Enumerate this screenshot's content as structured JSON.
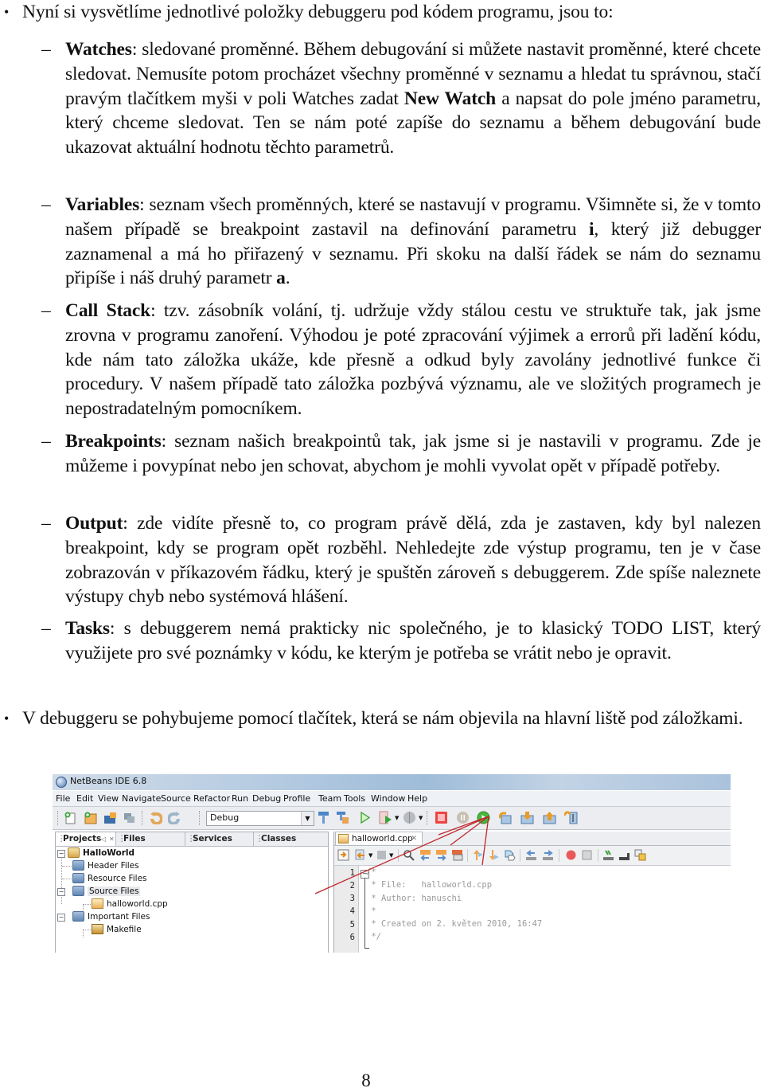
{
  "intro": {
    "bullet": "•",
    "text": "Nyní si vysvětlíme jednotlivé položky debuggeru pod kódem programu, jsou to:"
  },
  "items": [
    {
      "term": "Watches",
      "text_before": ": sledované proměnné. Během debugování si můžete nastavit proměnné, které chcete sledovat. Nemusíte potom procházet všechny proměnné v seznamu a hledat tu správnou, stačí pravým tlačítkem myši v poli Watches zadat ",
      "bold_inline": "New Watch",
      "text_after": " a napsat do pole jméno parametru, který chceme sledovat. Ten se nám poté zapíše do seznamu a během debugování bude ukazovat aktuální hodnotu těchto parametrů."
    },
    {
      "term": "Variables",
      "text_before": ": seznam všech proměnných, které se nastavují v programu. Všimněte si, že v tomto našem případě se breakpoint zastavil na definování parametru ",
      "bold_inline": "i",
      "text_middle": ", který již debugger zaznamenal a má ho přiřazený v seznamu. Při skoku na další řádek se nám do seznamu připíše i náš druhý parametr ",
      "bold_inline2": "a",
      "text_after": "."
    },
    {
      "term": "Call Stack",
      "text": ": tzv. zásobník volání, tj. udržuje vždy stálou cestu ve struktuře tak, jak jsme zrovna v programu zanoření. Výhodou je poté zpracování výjimek a errorů při ladění kódu, kde nám tato záložka ukáže, kde přesně a odkud byly zavolány jednotlivé funkce či procedury. V našem případě tato záložka pozbývá významu, ale ve složitých programech je nepostradatelným pomocníkem."
    },
    {
      "term": "Breakpoints",
      "text": ": seznam našich breakpointů tak, jak jsme si je nastavili v programu. Zde je můžeme i povypínat nebo jen schovat, abychom je mohli vyvolat opět v případě potřeby."
    },
    {
      "term": "Output",
      "text": ": zde vidíte přesně to, co program právě dělá, zda je zastaven, kdy byl nalezen breakpoint, kdy se program opět rozběhl. Nehledejte zde výstup programu, ten je v čase zobrazován v příkazovém řádku, který je spuštěn zároveň s debuggerem. Zde spíše naleznete výstupy chyb nebo systémová hlášení."
    },
    {
      "term": "Tasks",
      "text": ": s debuggerem nemá prakticky nic společného, je to klasický TODO LIST, který využijete pro své poznámky v kódu, ke kterým je potřeba se vrátit nebo je opravit."
    }
  ],
  "dash": "–",
  "closing": {
    "bullet": "•",
    "text": "V debuggeru se pohybujeme pomocí tlačítek, která se nám objevila na hlavní liště pod záložkami."
  },
  "screenshot": {
    "window_title": "NetBeans IDE 6.8",
    "menu": [
      "File",
      "Edit",
      "View",
      "Navigate",
      "Source",
      "Refactor",
      "Run",
      "Debug",
      "Profile",
      "Team",
      "Tools",
      "Window",
      "Help"
    ],
    "toolbar_icons": [
      "new-file-icon",
      "new-project-icon",
      "open-project-icon",
      "close-project-icon",
      "undo-icon",
      "redo-icon",
      "build-icon",
      "clean-build-icon",
      "run-icon",
      "debug-project-icon",
      "profile-icon",
      "finish-debugger-session-icon",
      "pause-icon",
      "continue-icon",
      "step-over-icon",
      "step-into-icon",
      "step-out-icon",
      "run-to-cursor-icon"
    ],
    "config_select": "Debug",
    "left_tabs": [
      "Projects",
      "Files",
      "Services",
      "Classes"
    ],
    "tree": [
      {
        "label": "HalloWorld",
        "icon": "project-icon",
        "bold": true
      },
      {
        "label": "Header Files",
        "icon": "folder-icon"
      },
      {
        "label": "Resource Files",
        "icon": "folder-icon"
      },
      {
        "label": "Source Files",
        "icon": "folder-icon"
      },
      {
        "label": "halloworld.cpp",
        "icon": "cpp-file-icon"
      },
      {
        "label": "Important Files",
        "icon": "folder-icon"
      },
      {
        "label": "Makefile",
        "icon": "makefile-icon"
      }
    ],
    "editor_tab": "halloworld.cpp",
    "editor_tab_close": "✕",
    "code_lines": [
      {
        "n": "1",
        "text": "/*"
      },
      {
        "n": "2",
        "text": " * File:   halloworld.cpp"
      },
      {
        "n": "3",
        "text": " * Author: hanuschi"
      },
      {
        "n": "4",
        "text": " *"
      },
      {
        "n": "5",
        "text": " * Created on 2. květen 2010, 16:47"
      },
      {
        "n": "6",
        "text": " */"
      }
    ],
    "annotation_color": "#c0272d"
  },
  "page_number": "8"
}
